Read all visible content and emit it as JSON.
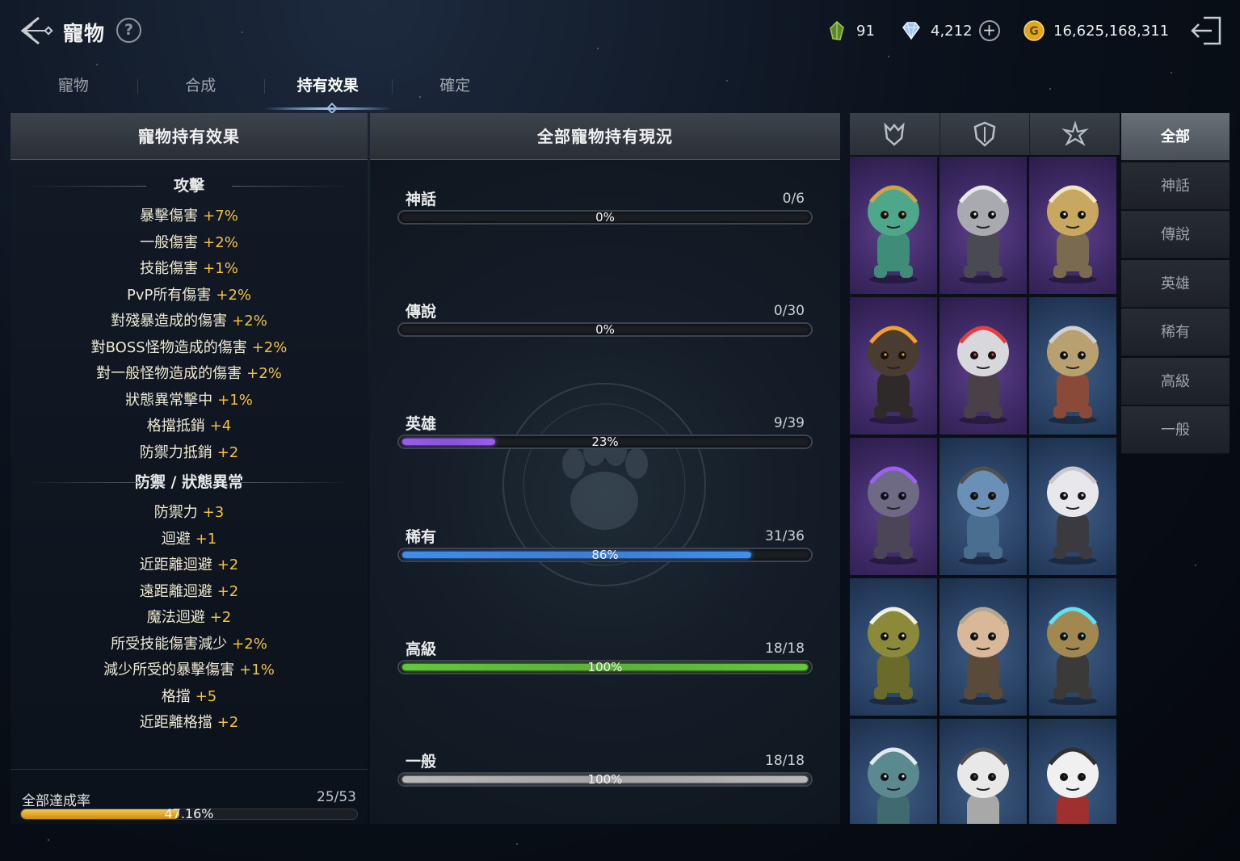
{
  "header": {
    "title": "寵物",
    "help_label": "?",
    "currencies": [
      {
        "name": "gem",
        "icon": "green-gem-icon",
        "value": "91",
        "has_plus": false
      },
      {
        "name": "diamond",
        "icon": "diamond-icon",
        "value": "4,212",
        "has_plus": true
      },
      {
        "name": "gold",
        "icon": "gold-coin-icon",
        "value": "16,625,168,311",
        "has_plus": false
      }
    ],
    "plus_label": "+",
    "gold_letter": "G"
  },
  "tabs": [
    {
      "label": "寵物",
      "active": false
    },
    {
      "label": "合成",
      "active": false
    },
    {
      "label": "持有效果",
      "active": true
    },
    {
      "label": "確定",
      "active": false
    }
  ],
  "left_panel": {
    "title": "寵物持有效果",
    "sections": [
      {
        "title": "攻擊",
        "effects": [
          {
            "name": "暴擊傷害",
            "value": "+7%"
          },
          {
            "name": "一般傷害",
            "value": "+2%"
          },
          {
            "name": "技能傷害",
            "value": "+1%"
          },
          {
            "name": "PvP所有傷害",
            "value": "+2%"
          },
          {
            "name": "對殘暴造成的傷害",
            "value": "+2%"
          },
          {
            "name": "對BOSS怪物造成的傷害",
            "value": "+2%"
          },
          {
            "name": "對一般怪物造成的傷害",
            "value": "+2%"
          },
          {
            "name": "狀態異常擊中",
            "value": "+1%"
          },
          {
            "name": "格擋抵銷",
            "value": "+4"
          },
          {
            "name": "防禦力抵銷",
            "value": "+2"
          }
        ]
      },
      {
        "title": "防禦 / 狀態異常",
        "effects": [
          {
            "name": "防禦力",
            "value": "+3"
          },
          {
            "name": "迴避",
            "value": "+1"
          },
          {
            "name": "近距離迴避",
            "value": "+2"
          },
          {
            "name": "遠距離迴避",
            "value": "+2"
          },
          {
            "name": "魔法迴避",
            "value": "+2"
          },
          {
            "name": "所受技能傷害減少",
            "value": "+2%"
          },
          {
            "name": "減少所受的暴擊傷害",
            "value": "+1%"
          },
          {
            "name": "格擋",
            "value": "+5"
          },
          {
            "name": "近距離格擋",
            "value": "+2"
          }
        ]
      }
    ],
    "total": {
      "label": "全部達成率",
      "count": "25/53",
      "percent_text": "47.16%",
      "progress": 0.4716
    }
  },
  "mid_panel": {
    "title": "全部寵物持有現況",
    "grades": [
      {
        "name": "神話",
        "count": "0/6",
        "percent_text": "0%",
        "progress": 0.0,
        "color": "#888888"
      },
      {
        "name": "傳說",
        "count": "0/30",
        "percent_text": "0%",
        "progress": 0.0,
        "color": "#888888"
      },
      {
        "name": "英雄",
        "count": "9/39",
        "percent_text": "23%",
        "progress": 0.23,
        "color": "#9a5cf0"
      },
      {
        "name": "稀有",
        "count": "31/36",
        "percent_text": "86%",
        "progress": 0.86,
        "color": "#3e8ef0"
      },
      {
        "name": "高級",
        "count": "18/18",
        "percent_text": "100%",
        "progress": 1.0,
        "color": "#62c83a"
      },
      {
        "name": "一般",
        "count": "18/18",
        "percent_text": "100%",
        "progress": 1.0,
        "color": "#b8b8b8"
      }
    ]
  },
  "pet_grid": {
    "type_tabs": [
      {
        "icon": "attack-type-icon"
      },
      {
        "icon": "defense-type-icon"
      },
      {
        "icon": "support-type-icon"
      }
    ],
    "pets": [
      {
        "grade": "purple",
        "icon": "dragon-pet-icon",
        "body": "#3f8c78",
        "head": "#4ea78b",
        "accent": "#c9a64a"
      },
      {
        "grade": "purple",
        "icon": "skull-knight-pet-icon",
        "body": "#4a4a52",
        "head": "#a8aab0",
        "accent": "#e8e8e8"
      },
      {
        "grade": "purple",
        "icon": "valkyrie-pet-icon",
        "body": "#7a6a50",
        "head": "#c8a860",
        "accent": "#f2e6c0"
      },
      {
        "grade": "purple",
        "icon": "horned-beast-pet-icon",
        "body": "#2f2a2a",
        "head": "#4a3c30",
        "accent": "#f0a030"
      },
      {
        "grade": "purple",
        "icon": "white-mane-skull-pet-icon",
        "body": "#4a4048",
        "head": "#d8d8dc",
        "accent": "#e04040"
      },
      {
        "grade": "blue",
        "icon": "helmed-warrior-pet-icon",
        "body": "#8a4a3a",
        "head": "#b8a070",
        "accent": "#d0d0d0"
      },
      {
        "grade": "purple",
        "icon": "horned-boar-pet-icon",
        "body": "#4a4658",
        "head": "#6e6a84",
        "accent": "#9a60f0"
      },
      {
        "grade": "blue",
        "icon": "blue-lion-pet-icon",
        "body": "#4a6e90",
        "head": "#6a90b8",
        "accent": "#505050"
      },
      {
        "grade": "blue",
        "icon": "white-hair-elf-pet-icon",
        "body": "#3a3a40",
        "head": "#e8e8ec",
        "accent": "#c8c8cc"
      },
      {
        "grade": "blue",
        "icon": "green-boar-pet-icon",
        "body": "#6a6a2a",
        "head": "#8a8a3a",
        "accent": "#f0f0e0"
      },
      {
        "grade": "blue",
        "icon": "viking-dwarf-pet-icon",
        "body": "#5a4a3a",
        "head": "#d8b898",
        "accent": "#b0a890"
      },
      {
        "grade": "blue",
        "icon": "pyramid-guardian-pet-icon",
        "body": "#3a3a38",
        "head": "#a08850",
        "accent": "#60e0f0"
      },
      {
        "grade": "blue",
        "icon": "spiked-beast-pet-icon",
        "body": "#3e6a70",
        "head": "#5a8a90",
        "accent": "#e0e8f0"
      },
      {
        "grade": "blue",
        "icon": "white-lion-pet-icon",
        "body": "#a8a8a8",
        "head": "#e8e8e8",
        "accent": "#505050"
      },
      {
        "grade": "blue",
        "icon": "red-cape-bunny-pet-icon",
        "body": "#a03030",
        "head": "#f0f0f0",
        "accent": "#303030"
      }
    ]
  },
  "grade_filters": [
    {
      "label": "全部",
      "active": true
    },
    {
      "label": "神話",
      "active": false
    },
    {
      "label": "傳說",
      "active": false
    },
    {
      "label": "英雄",
      "active": false
    },
    {
      "label": "稀有",
      "active": false
    },
    {
      "label": "高級",
      "active": false
    },
    {
      "label": "一般",
      "active": false
    }
  ]
}
